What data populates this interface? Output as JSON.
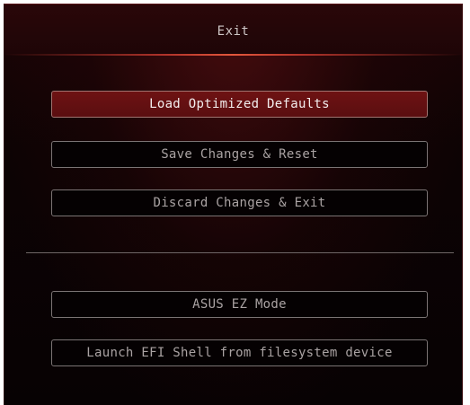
{
  "dialog": {
    "title": "Exit"
  },
  "actions": [
    {
      "label": "Load Optimized Defaults",
      "selected": true
    },
    {
      "label": "Save Changes & Reset",
      "selected": false
    },
    {
      "label": "Discard Changes & Exit",
      "selected": false
    }
  ],
  "modes": [
    {
      "label": "ASUS EZ Mode"
    },
    {
      "label": "Launch EFI Shell from filesystem device"
    }
  ],
  "colors": {
    "accent": "#6e1213",
    "background": "#0d0304"
  }
}
